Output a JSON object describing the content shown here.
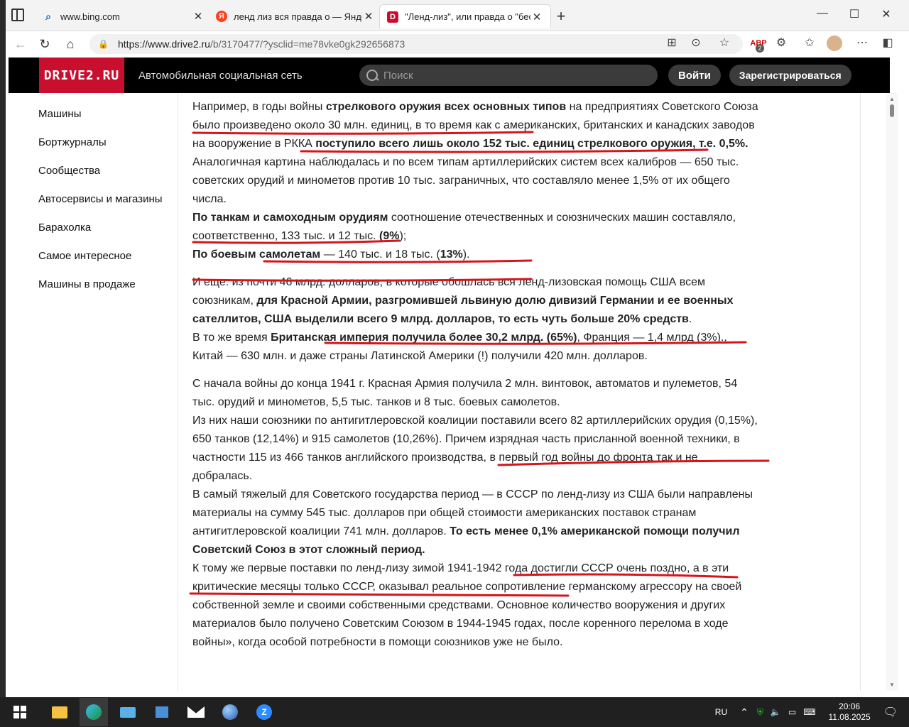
{
  "tabs": [
    {
      "label": "www.bing.com",
      "icon": "search-icon"
    },
    {
      "label": "ленд лиз вся правда о — Яндекс",
      "icon": "yandex-icon"
    },
    {
      "label": "\"Ленд-лиз\", или правда о \"беско",
      "icon": "drive2-icon"
    }
  ],
  "address": {
    "host": "https://www.drive2.ru",
    "path": "/b/3170477/?ysclid=me78vke0gk292656873"
  },
  "extension_badge": "2",
  "site": {
    "logo": "DRIVE2.RU",
    "tagline": "Автомобильная социальная сеть",
    "search_placeholder": "Поиск",
    "login": "Войти",
    "register": "Зарегистрироваться"
  },
  "sidebar": [
    "Машины",
    "Бортжурналы",
    "Сообщества",
    "Автосервисы и магазины",
    "Барахолка",
    "Самое интересное",
    "Машины в продаже"
  ],
  "article": {
    "p1a": "Например, в годы войны ",
    "p1b": "стрелкового оружия всех основных типов",
    "p1c": " на предприятиях Советского Союза было произведено около 30 млн. единиц, в то время как с американских, британских и канадских заводов на вооружение в РККА ",
    "p1d": "поступило всего лишь около 152 тыс. единиц стрелкового оружия, т.е. 0,5%.",
    "p1e": "Аналогичная картина наблюдалась и по всем типам артиллерийских систем всех калибров — 650 тыс. советских орудий и минометов против 10 тыс. заграничных, что составляло менее 1,5% от их общего числа.",
    "p1f": "По танкам и самоходным орудиям",
    "p1g": " соотношение отечественных и союзнических машин составляло, соответственно, 133 тыс. и 12 тыс. ",
    "p1h": "(9%",
    "p1i": ");",
    "p1j": "По боевым самолетам",
    "p1k": " — 140 тыс. и 18 тыс. (",
    "p1l": "13%",
    "p1m": ").",
    "p2a": "И еще: из почти 46 млрд. долларов, в которые обошлась вся ленд-лизовская помощь США всем союзникам, ",
    "p2b": "для Красной Армии, разгромившей львиную долю дивизий Германии и ее военных сателлитов, США выделили всего 9 млрд. долларов, то есть чуть больше 20% средств",
    "p2c": ".",
    "p2d": "В то же время ",
    "p2e": "Британская империя получила более 30,2 млрд. (65%)",
    "p2f": ", Франция — 1,4 млрд (3%)., Китай — 630 млн. и даже страны Латинской Америки (!) получили 420 млн. долларов.",
    "p3a": "С начала войны до конца 1941 г. Красная Армия получила 2 млн. винтовок, автоматов и пулеметов, 54 тыс. орудий и минометов, 5,5 тыс. танков и 8 тыс. боевых самолетов.",
    "p3b": "Из них наши союзники по антигитлеровской коалиции поставили всего 82 артиллерийских орудия (0,15%), 650 танков (12,14%) и 915 самолетов (10,26%). Причем изрядная часть присланной военной техники, в частности 115 из 466 танков английского производства, в первый год войны до фронта так и не добралась.",
    "p3c": "В самый тяжелый для Советского государства период — в СССР по ленд-лизу из США были направлены материалы на сумму 545 тыс. долларов при общей стоимости американских поставок странам антигитлеровской коалиции 741 млн. долларов. ",
    "p3d": "То есть менее 0,1% американской помощи получил Советский Союз в этот сложный период.",
    "p3e": "К тому же первые поставки по ленд-лизу зимой 1941-1942 года достигли СССР очень поздно, а в эти критические месяцы только СССР, оказывал реальное сопротивление германскому агрессору на своей собственной земле и своими собственными средствами. Основное количество вооружения и других материалов было получено Советским Союзом в 1944-1945 годах, после коренного перелома в ходе войны», когда особой потребности в помощи союзников уже не было."
  },
  "tray": {
    "lang": "RU",
    "time": "20:06",
    "date": "11.08.2025"
  }
}
